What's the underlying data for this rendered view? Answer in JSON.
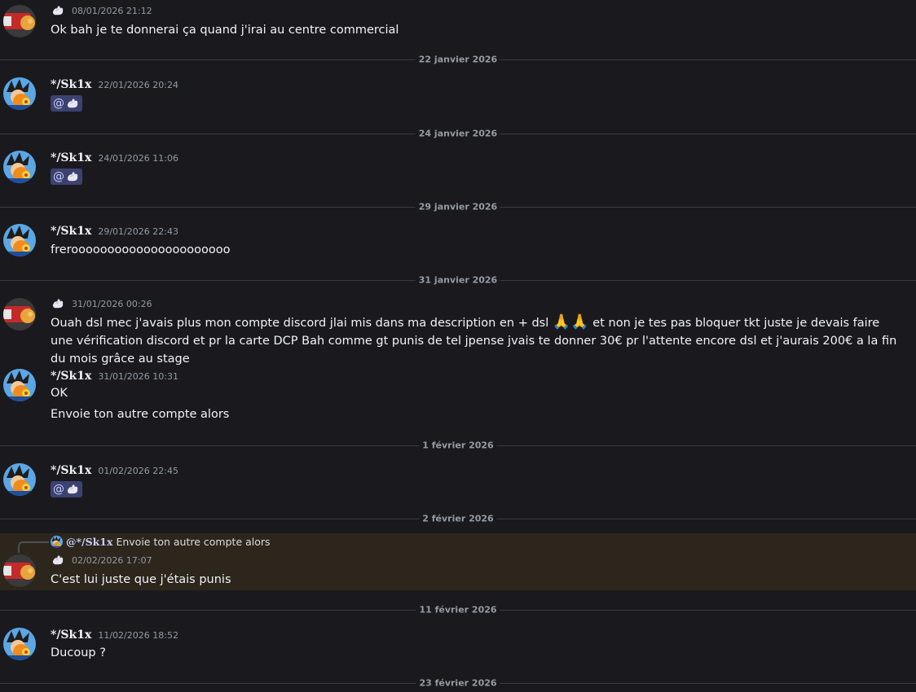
{
  "colors": {
    "background": "#1a1a1e",
    "highlight": "#2c261d",
    "mention": "#3c4270",
    "timestamp": "#949ba4"
  },
  "users": {
    "sk1x": "*/Sk1x",
    "mention_prefix": "@"
  },
  "dividers": [
    "22 janvier 2026",
    "24 janvier 2026",
    "29 janvier 2026",
    "31 janvier 2026",
    "1 février 2026",
    "2 février 2026",
    "11 février 2026",
    "23 février 2026"
  ],
  "messages": [
    {
      "ts": "08/01/2026 21:12",
      "text": "Ok bah je te donnerai ça quand j'irai au centre commercial"
    },
    {
      "ts": "22/01/2026 20:24",
      "text": "@"
    },
    {
      "ts": "24/01/2026 11:06",
      "text": "@"
    },
    {
      "ts": "29/01/2026 22:43",
      "text": "freroooooooooooooooooooooo"
    },
    {
      "ts": "31/01/2026 00:26",
      "text_before": "Ouah dsl mec j'avais plus mon compte discord jlai mis dans ma description en + dsl ",
      "emoji": "🙏🙏",
      "text_after": " et non je tes pas bloquer tkt juste je devais faire une vérification discord et pr la carte DCP Bah comme gt punis de tel jpense jvais te donner 30€ pr l'attente encore dsl et j'aurais 200€ a la fin du mois grâce au stage"
    },
    {
      "ts": "31/01/2026 10:31",
      "text": "OK",
      "text2": "Envoie ton autre compte  alors"
    },
    {
      "ts": "01/02/2026 22:45",
      "text": "@"
    },
    {
      "ts": "02/02/2026 17:07",
      "text": "C'est lui juste que j'étais punis",
      "reply_to": "@*/Sk1x",
      "reply_text": "Envoie ton autre compte  alors"
    },
    {
      "ts": "11/02/2026 18:52",
      "text": "Ducoup ?"
    }
  ]
}
